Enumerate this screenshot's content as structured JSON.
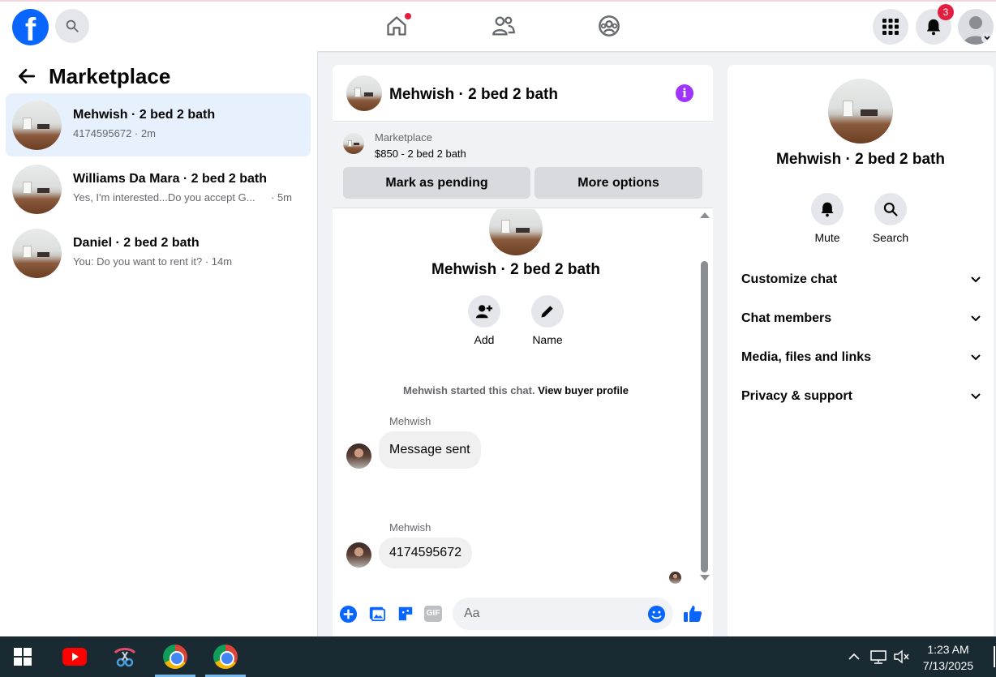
{
  "topnav": {
    "logo_letter": "f",
    "notifications_count": "3",
    "icons": [
      "search-icon",
      "home-icon",
      "friends-icon",
      "groups-icon",
      "menu-grid-icon",
      "bell-icon",
      "account-icon"
    ]
  },
  "left": {
    "title": "Marketplace",
    "conversations": [
      {
        "title": "Mehwish · 2 bed 2 bath",
        "subtitle": "4174595672 · 2m",
        "time": "",
        "active": true
      },
      {
        "title": "Williams Da Mara · 2 bed 2 bath",
        "subtitle": "Yes, I'm interested...Do you accept G...",
        "time": "· 5m",
        "active": false
      },
      {
        "title": "Daniel · 2 bed 2 bath",
        "subtitle": "You: Do you want to rent it? · 14m",
        "time": "",
        "active": false
      }
    ]
  },
  "chat": {
    "title": "Mehwish · 2 bed 2 bath",
    "marketplace_label": "Marketplace",
    "listing": "$850 - 2 bed 2 bath",
    "mark_pending": "Mark as pending",
    "more_options": "More options",
    "name": "Mehwish · 2 bed 2 bath",
    "add_label": "Add",
    "name_label": "Name",
    "started_text": "Mehwish started this chat.",
    "view_profile": "View buyer profile",
    "messages": [
      {
        "sender": "Mehwish",
        "text": "Message sent"
      },
      {
        "sender": "Mehwish",
        "text": "4174595672"
      }
    ],
    "composer_placeholder": "Aa",
    "gif_label": "GIF"
  },
  "right": {
    "name": "Mehwish · 2 bed 2 bath",
    "mute_label": "Mute",
    "search_label": "Search",
    "sections": [
      "Customize chat",
      "Chat members",
      "Media, files and links",
      "Privacy & support"
    ]
  },
  "taskbar": {
    "time": "1:23 AM",
    "date": "7/13/2025"
  },
  "colors": {
    "brand": "#0866ff",
    "badge": "#e41e3f",
    "info": "#a033ff",
    "active_conversation": "#e7f0fd"
  }
}
